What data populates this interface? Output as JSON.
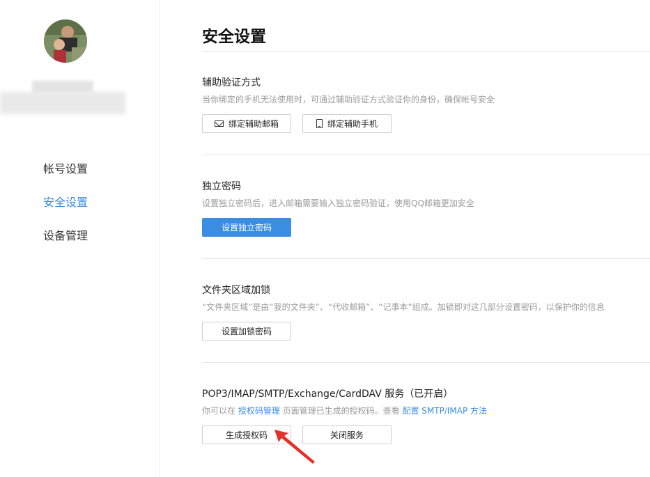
{
  "sidebar": {
    "nav": [
      {
        "label": "帐号设置"
      },
      {
        "label": "安全设置"
      },
      {
        "label": "设备管理"
      }
    ]
  },
  "main": {
    "title": "安全设置",
    "sections": [
      {
        "title": "辅助验证方式",
        "desc": "当你绑定的手机无法使用时，可通过辅助验证方式验证你的身份，确保帐号安全",
        "buttons": [
          {
            "label": "绑定辅助邮箱",
            "icon": "mail-icon"
          },
          {
            "label": "绑定辅助手机",
            "icon": "phone-icon"
          }
        ]
      },
      {
        "title": "独立密码",
        "desc": "设置独立密码后，进入邮箱需要输入独立密码验证，使用QQ邮箱更加安全",
        "buttons": [
          {
            "label": "设置独立密码"
          }
        ]
      },
      {
        "title": "文件夹区域加锁",
        "desc": "“文件夹区域”是由“我的文件夹”、“代收邮箱”、“记事本”组成。加锁即对这几部分设置密码，以保护你的信息",
        "buttons": [
          {
            "label": "设置加锁密码"
          }
        ]
      },
      {
        "title": "POP3/IMAP/SMTP/Exchange/CardDAV 服务（已开启）",
        "desc_parts": {
          "pre": "你可以在 ",
          "link1": "授权码管理",
          "mid": " 页面管理已生成的授权码。查看 ",
          "link2": "配置 SMTP/IMAP 方法"
        },
        "buttons": [
          {
            "label": "生成授权码"
          },
          {
            "label": "关闭服务"
          }
        ]
      }
    ]
  },
  "colors": {
    "accent": "#3a8de0",
    "annotation_arrow": "#e5312c"
  }
}
